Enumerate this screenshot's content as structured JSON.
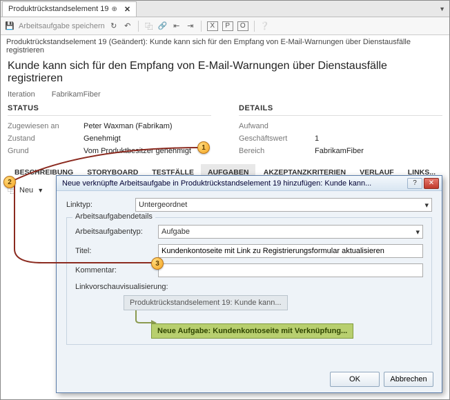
{
  "tab": {
    "title": "Produktrückstandselement 19"
  },
  "toolbar": {
    "save_label": "Arbeitsaufgabe speichern",
    "boxed": [
      "X",
      "P",
      "O"
    ]
  },
  "crumb": "Produktrückstandselement 19 (Geändert): Kunde kann sich für den Empfang von E-Mail-Warnungen über Dienstausfälle registrieren",
  "title": "Kunde kann sich für den Empfang von E-Mail-Warnungen über Dienstausfälle registrieren",
  "iteration": {
    "label": "Iteration",
    "value": "FabrikamFiber"
  },
  "status": {
    "header": "STATUS",
    "assigned_label": "Zugewiesen an",
    "assigned_value": "Peter Waxman (Fabrikam)",
    "state_label": "Zustand",
    "state_value": "Genehmigt",
    "reason_label": "Grund",
    "reason_value": "Vom Produktbesitzer genehmigt"
  },
  "details": {
    "header": "DETAILS",
    "effort_label": "Aufwand",
    "effort_value": "",
    "biz_label": "Geschäftswert",
    "biz_value": "1",
    "area_label": "Bereich",
    "area_value": "FabrikamFiber"
  },
  "tabs_left": [
    "BESCHREIBUNG",
    "STORYBOARD",
    "TESTFÄLLE",
    "AUFGABEN"
  ],
  "tabs_right": [
    "AKZEPTANZKRITERIEN",
    "VERLAUF",
    "LINKS..."
  ],
  "newbar": {
    "label": "Neu"
  },
  "callouts": {
    "one": "1",
    "two": "2",
    "three": "3"
  },
  "dialog": {
    "title": "Neue verknüpfte Arbeitsaufgabe in Produktrückstandselement 19 hinzufügen: Kunde kann...",
    "linktype_label": "Linktyp:",
    "linktype_value": "Untergeordnet",
    "fieldset_legend": "Arbeitsaufgabendetails",
    "type_label": "Arbeitsaufgabentyp:",
    "type_value": "Aufgabe",
    "title_label": "Titel:",
    "title_value": "Kundenkontoseite mit Link zu Registrierungsformular aktualisieren",
    "comment_label": "Kommentar:",
    "comment_value": "",
    "preview_label": "Linkvorschauvisualisierung:",
    "preview_parent": "Produktrückstandselement 19: Kunde kann...",
    "preview_child": "Neue Aufgabe: Kundenkontoseite mit Verknüpfung...",
    "ok": "OK",
    "cancel": "Abbrechen"
  }
}
